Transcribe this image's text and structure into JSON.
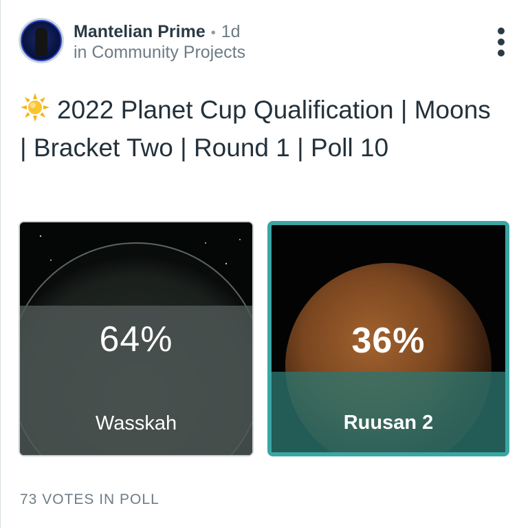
{
  "post": {
    "author": "Mantelian Prime",
    "separator": "•",
    "time_ago": "1d",
    "community": "in Community Projects",
    "title_icon": "sun-icon",
    "title": "2022 Planet Cup Qualification | Moons | Bracket Two | Round 1 | Poll 10"
  },
  "poll": {
    "options": [
      {
        "name": "Wasskah",
        "percent_label": "64%",
        "percent": 64,
        "selected": false
      },
      {
        "name": "Ruusan 2",
        "percent_label": "36%",
        "percent": 36,
        "selected": true
      }
    ],
    "votes_label": "73 VOTES IN POLL"
  },
  "colors": {
    "selected_border": "#3aa6a4",
    "title_text": "#23313b",
    "muted_text": "#6d7c85"
  }
}
